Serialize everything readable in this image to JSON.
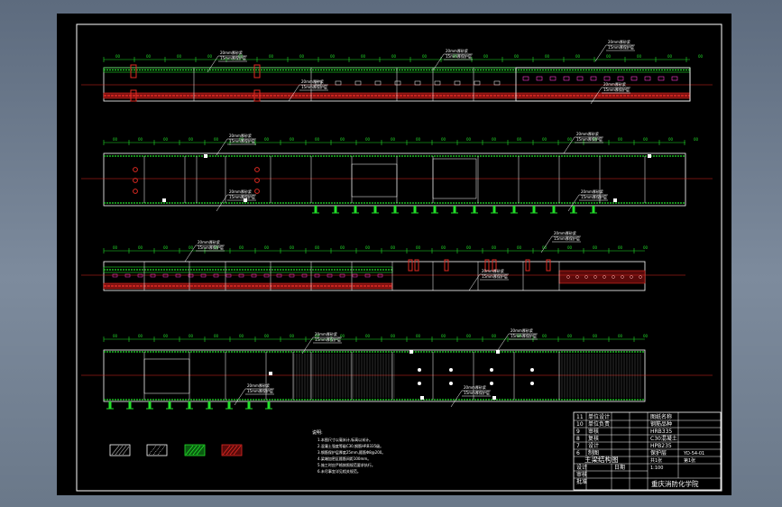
{
  "title_block": {
    "drawing_title": "主梁结构图",
    "drawing_number": "YD-54-01",
    "school": "重庆消防化学院",
    "scale": "1:100",
    "sheet": "共1张",
    "revision": "第1张",
    "rows": [
      {
        "no": "11",
        "part": "单位设计",
        "qty": "",
        "spec": "",
        "remark": "图纸名称"
      },
      {
        "no": "10",
        "part": "单位负责",
        "qty": "",
        "spec": "",
        "remark": "钢筋品种"
      },
      {
        "no": "9",
        "part": "审核",
        "qty": "",
        "spec": "",
        "remark": "HRB335"
      },
      {
        "no": "8",
        "part": "复核",
        "qty": "",
        "spec": "",
        "remark": "C30混凝土"
      },
      {
        "no": "7",
        "part": "设计",
        "qty": "",
        "spec": "",
        "remark": "HPB235"
      },
      {
        "no": "6",
        "part": "制图",
        "qty": "",
        "spec": "",
        "remark": "保护层"
      }
    ],
    "labels": {
      "design": "设计",
      "check": "审核",
      "approve": "批准",
      "date": "日期"
    }
  },
  "callout_text": {
    "top": "20mm厚砂浆",
    "bottom": "15mm厚保护层"
  },
  "notes": {
    "title": "说明:",
    "lines": [
      "1.本图尺寸以毫米计,标高以米计。",
      "2.混凝土强度等级C30,钢筋HRB335级。",
      "3.钢筋保护层厚度25mm,箍筋Φ8@200。",
      "4.梁端加密区箍筋间距100mm。",
      "5.施工时应严格按照规范要求执行。",
      "6.未尽事宜详见相关规范。"
    ]
  },
  "legend": {
    "items": [
      {
        "name": "legend-concrete",
        "color": "#c9c9c9"
      },
      {
        "name": "legend-mortar",
        "color": "#dcdcdc"
      },
      {
        "name": "legend-green",
        "color": "#22e02a"
      },
      {
        "name": "legend-red",
        "color": "#e02a22"
      }
    ]
  },
  "colors": {
    "line": "#ffffff",
    "green": "#22e02a",
    "red": "#e02a22",
    "magenta": "#ff3bd0",
    "blue": "#4a6aff",
    "paper": "#000000"
  }
}
